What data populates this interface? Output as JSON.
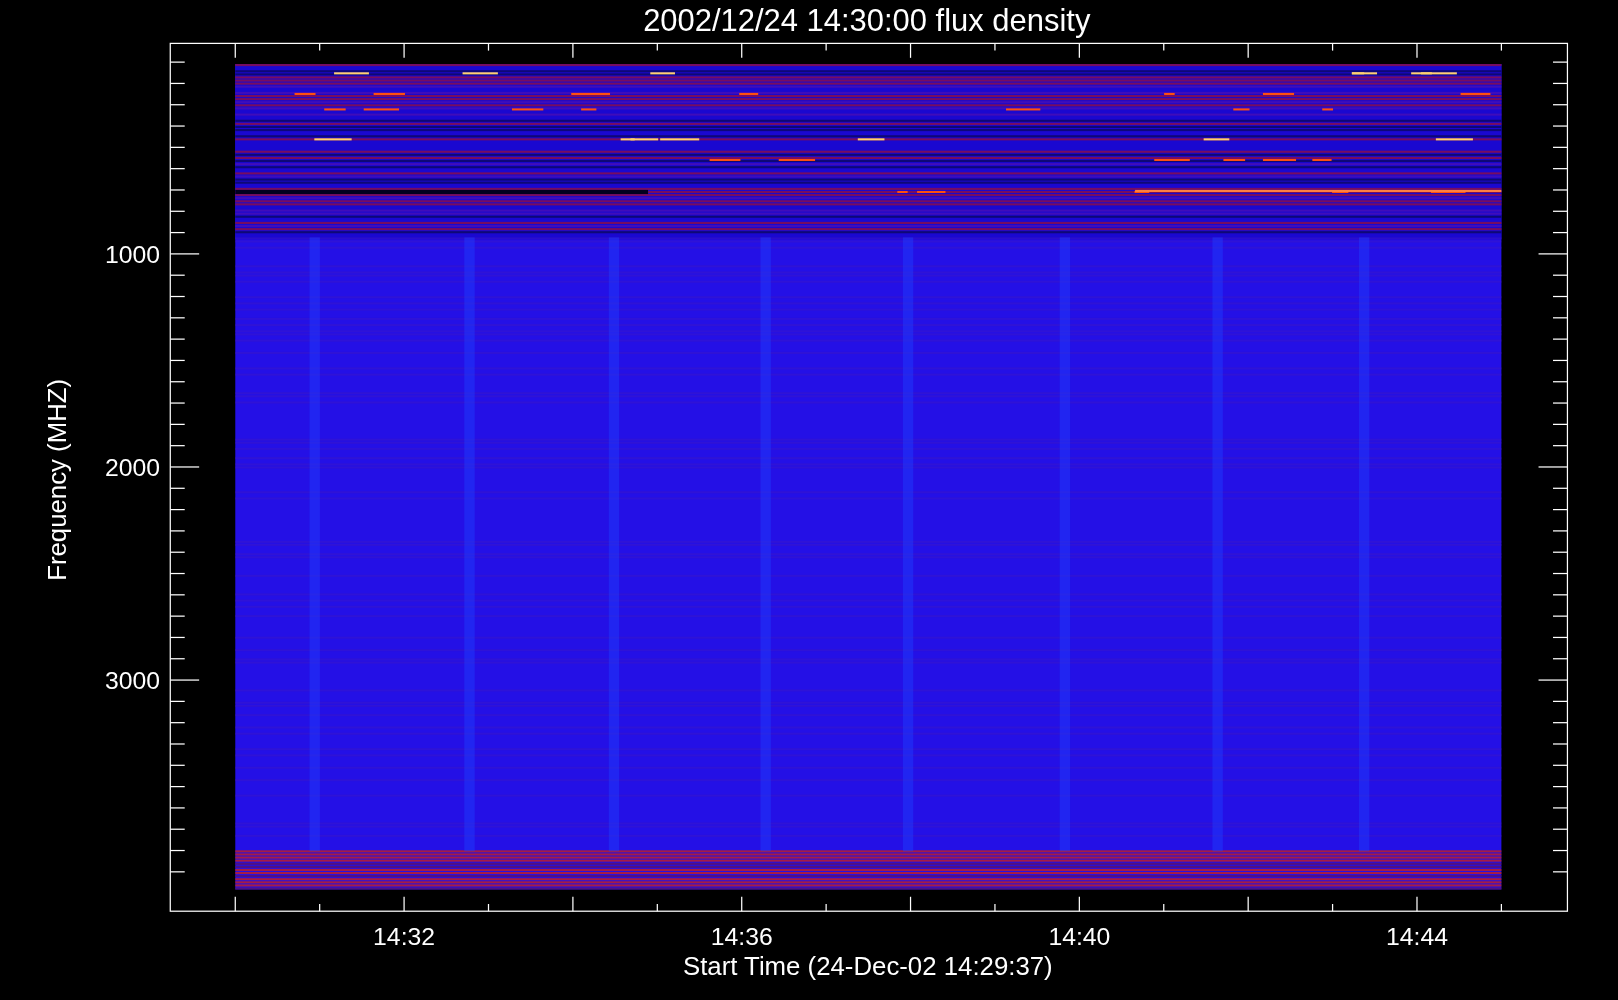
{
  "plot": {
    "title": "2002/12/24 14:30:00 flux density",
    "xlabel": "Start Time (24-Dec-02 14:29:37)",
    "ylabel": "Frequency (MHZ)",
    "xtick_labels": [
      "14:32",
      "14:36",
      "14:40",
      "14:44"
    ],
    "ytick_labels": [
      "1000",
      "2000",
      "3000"
    ]
  }
}
